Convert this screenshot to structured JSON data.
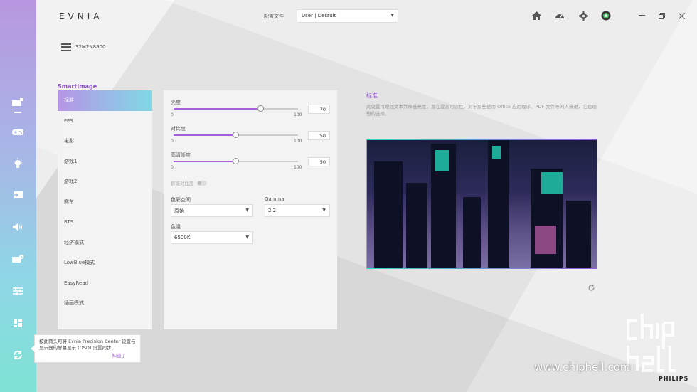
{
  "app": {
    "logo": "EVNIA",
    "brand": "PHILIPS"
  },
  "header": {
    "profile_label": "配置文件",
    "profile_value": "User | Default"
  },
  "monitor": {
    "name": "32M2N8800"
  },
  "smartimage": {
    "title": "SmartImage",
    "modes": [
      "标准",
      "FPS",
      "电影",
      "游戏1",
      "游戏2",
      "赛车",
      "RTS",
      "经济模式",
      "LowBlue模式",
      "EasyRead",
      "插画模式"
    ],
    "active_index": 0
  },
  "settings": {
    "sliders": [
      {
        "label": "亮度",
        "min": "0",
        "max": "100",
        "value": "70"
      },
      {
        "label": "对比度",
        "min": "0",
        "max": "100",
        "value": "50"
      },
      {
        "label": "高清晰度",
        "min": "0",
        "max": "100",
        "value": "50"
      }
    ],
    "smart_contrast_label": "智能对比度",
    "color_space_label": "色彩空间",
    "color_space_value": "原始",
    "gamma_label": "Gamma",
    "gamma_value": "2.2",
    "color_temp_label": "色温",
    "color_temp_value": "6500K"
  },
  "preview": {
    "title": "标准",
    "description": "此设置可增强文本并降低亮度，旨在提高可读性。对于那些使用 Office 应用程序、PDF 文件等的人来说，它是理想的选择。"
  },
  "tooltip": {
    "text": "按此箭头可将 Evnia Precision Center 设置与显示器的屏幕显示 (OSD) 设置同步。",
    "link": "知道了"
  },
  "watermark": {
    "url": "www.chiphell.com"
  },
  "colors": {
    "accent": "#a45fd9",
    "teal": "#2fd5c7"
  }
}
